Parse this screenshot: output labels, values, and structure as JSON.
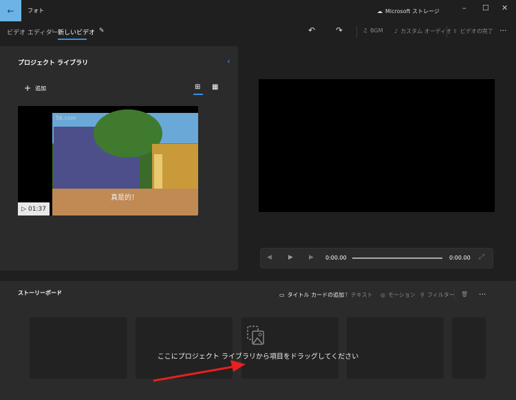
{
  "titlebar": {
    "app_name": "フォト",
    "storage_label": "Microsoft ストレージ",
    "minimize": "–",
    "maximize": "☐",
    "close": "✕"
  },
  "breadcrumb": {
    "parent": "ビデオ エディター",
    "separator": ">",
    "current": "新しいビデオ"
  },
  "toolbar": {
    "undo": "↶",
    "redo": "↷",
    "bgm": "BGM",
    "custom_audio": "カスタム オーディオ",
    "finish_video": "ビデオの完了",
    "more": "···"
  },
  "library": {
    "title": "プロジェクト ライブラリ",
    "collapse": "‹",
    "add_label": "追加",
    "add_icon": "+",
    "items": [
      {
        "duration": "01:37",
        "watermark": "56.com",
        "subtitle": "真是的！"
      }
    ]
  },
  "player": {
    "current_time": "0:00.00",
    "total_time": "0:00.00",
    "progress": 0
  },
  "storyboard": {
    "title": "ストーリーボード",
    "add_title_card": "タイトル カードの追加",
    "text": "テキスト",
    "motion": "モーション",
    "filter": "フィルター",
    "more": "···",
    "empty_message": "ここにプロジェクト ライブラリから項目をドラッグしてください"
  },
  "colors": {
    "accent": "#3a8ee6",
    "back_button": "#6cb4e6",
    "annotation_arrow": "#e82020"
  }
}
